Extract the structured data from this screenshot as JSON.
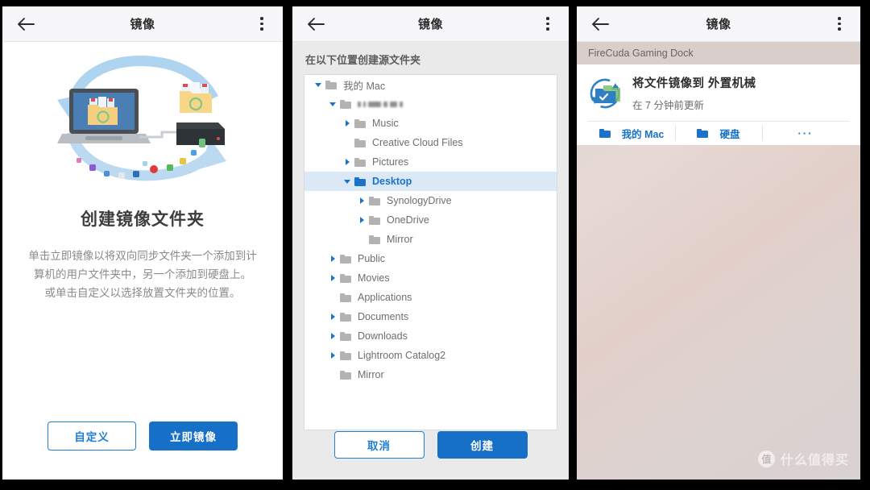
{
  "titlebar": {
    "title": "镜像",
    "back_icon": "back-arrow-icon",
    "menu_icon": "overflow-menu-icon"
  },
  "panel1": {
    "heading": "创建镜像文件夹",
    "desc_line1": "单击立即镜像以将双向同步文件夹一个添加到计",
    "desc_line2": "算机的用户文件夹中，另一个添加到硬盘上。",
    "desc_line3": "或单击自定义以选择放置文件夹的位置。",
    "btn_custom": "自定义",
    "btn_mirror_now": "立即镜像",
    "illustration": "laptop-sync-harddrive-illustration"
  },
  "panel2": {
    "header": "在以下位置创建源文件夹",
    "btn_cancel": "取消",
    "btn_create": "创建",
    "tree": [
      {
        "label": "我的 Mac",
        "indent": 0,
        "caret": "down",
        "selected": false,
        "blurred": false
      },
      {
        "label": "",
        "indent": 1,
        "caret": "down",
        "selected": false,
        "blurred": true
      },
      {
        "label": "Music",
        "indent": 2,
        "caret": "right",
        "selected": false,
        "blurred": false
      },
      {
        "label": "Creative Cloud Files",
        "indent": 2,
        "caret": "none",
        "selected": false,
        "blurred": false
      },
      {
        "label": "Pictures",
        "indent": 2,
        "caret": "right",
        "selected": false,
        "blurred": false
      },
      {
        "label": "Desktop",
        "indent": 2,
        "caret": "down",
        "selected": true,
        "blurred": false
      },
      {
        "label": "SynologyDrive",
        "indent": 3,
        "caret": "right",
        "selected": false,
        "blurred": false
      },
      {
        "label": "OneDrive",
        "indent": 3,
        "caret": "right",
        "selected": false,
        "blurred": false
      },
      {
        "label": "Mirror",
        "indent": 3,
        "caret": "none",
        "selected": false,
        "blurred": false
      },
      {
        "label": "Public",
        "indent": 1,
        "caret": "right",
        "selected": false,
        "blurred": false
      },
      {
        "label": "Movies",
        "indent": 1,
        "caret": "right",
        "selected": false,
        "blurred": false
      },
      {
        "label": "Applications",
        "indent": 1,
        "caret": "none",
        "selected": false,
        "blurred": false
      },
      {
        "label": "Documents",
        "indent": 1,
        "caret": "right",
        "selected": false,
        "blurred": false
      },
      {
        "label": "Downloads",
        "indent": 1,
        "caret": "right",
        "selected": false,
        "blurred": false
      },
      {
        "label": "Lightroom Catalog2",
        "indent": 1,
        "caret": "right",
        "selected": false,
        "blurred": false
      },
      {
        "label": "Mirror",
        "indent": 1,
        "caret": "none",
        "selected": false,
        "blurred": false
      }
    ]
  },
  "panel3": {
    "dock_name": "FireCuda Gaming Dock",
    "mirror_title": "将文件镜像到 外置机械",
    "mirror_status": "在 7 分钟前更新",
    "tabs": [
      {
        "label": "我的 Mac",
        "icon": "folder-icon"
      },
      {
        "label": "硬盘",
        "icon": "folder-icon"
      },
      {
        "label": "···",
        "icon": "more-icon"
      }
    ],
    "sync_icon": "sync-folder-icon"
  },
  "watermark": {
    "badge": "值",
    "text": "什么值得买"
  },
  "colors": {
    "accent": "#1770c8",
    "accent_light": "#1a73c8",
    "selection": "#dbe9f7",
    "folder_gray": "#b3b3b3"
  }
}
